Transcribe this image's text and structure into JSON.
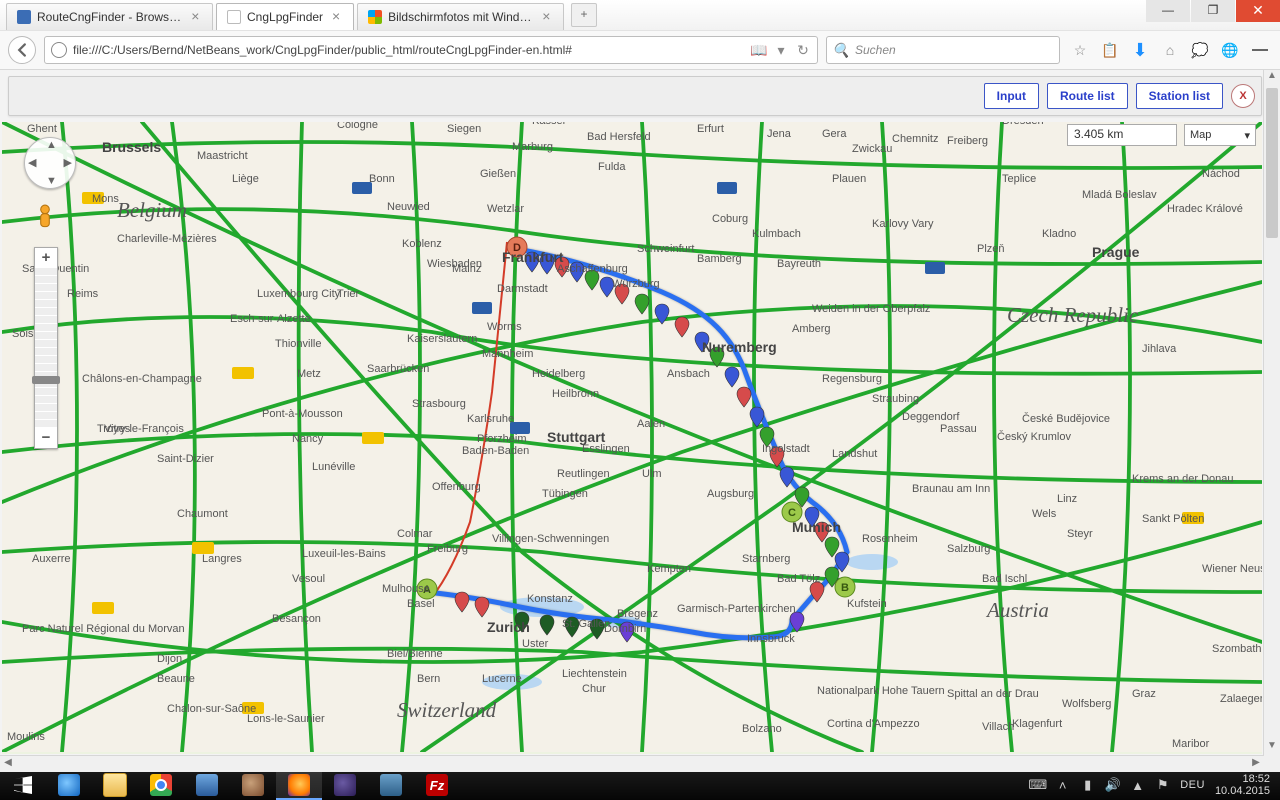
{
  "window": {
    "tabs": [
      {
        "label": "RouteCngFinder - Browse …"
      },
      {
        "label": "CngLpgFinder"
      },
      {
        "label": "Bildschirmfotos mit Windo…"
      }
    ],
    "controls": {
      "min": "—",
      "max": "❐",
      "close": "✕"
    }
  },
  "toolbar": {
    "url": "file:///C:/Users/Bernd/NetBeans_work/CngLpgFinder/public_html/routeCngLpgFinder-en.html#",
    "search_placeholder": "Suchen",
    "icons": {
      "reader": "📖",
      "dropdown": "▾",
      "reload": "↻",
      "magnifier": "🔍",
      "star": "☆",
      "clipboard": "📋",
      "download": "⬇",
      "home": "⌂",
      "chat": "💭",
      "globe": "🌐"
    }
  },
  "app": {
    "buttons": {
      "input": "Input",
      "route_list": "Route list",
      "station_list": "Station list"
    },
    "close": "X"
  },
  "map": {
    "distance": "3.405 km",
    "type": "Map",
    "countries": {
      "be": "Belgium",
      "ch": "Switzerland",
      "at": "Austria",
      "cz": "Czech Republic",
      "li": "Liechtenstein"
    },
    "cities": {
      "brussels": "Brussels",
      "maastricht": "Maastricht",
      "cologne": "Cologne",
      "siegen": "Siegen",
      "bonn": "Bonn",
      "koblenz": "Koblenz",
      "frankfurt": "Frankfurt",
      "darmstadt": "Darmstadt",
      "mannheim": "Mannheim",
      "heidelberg": "Heidelberg",
      "karlsruhe": "Karlsruhe",
      "stuttgart": "Stuttgart",
      "pforzheim": "Pforzheim",
      "freiburg": "Freiburg",
      "basel": "Basel",
      "zurich": "Zurich",
      "konstanz": "Konstanz",
      "stgallen": "St. Gallen",
      "ulm": "Ulm",
      "augsburg": "Augsburg",
      "munich": "Munich",
      "nuremberg": "Nuremberg",
      "wurzburg": "Würzburg",
      "regensburg": "Regensburg",
      "ingolstadt": "Ingolstadt",
      "salzburg": "Salzburg",
      "innsbruck": "Innsbruck",
      "linz": "Linz",
      "graz": "Graz",
      "klagenfurt": "Klagenfurt",
      "prague": "Prague",
      "plzen": "Plzeň",
      "dresden": "Dresden",
      "chemnitz": "Chemnitz",
      "erfurt": "Erfurt",
      "kassel": "Kassel",
      "marburg": "Marburg",
      "fulda": "Fulda",
      "bayreuth": "Bayreuth",
      "bamberg": "Bamberg",
      "schweinfurt": "Schweinfurt",
      "aschaffen": "Aschaffenburg",
      "mainz": "Mainz",
      "wiesbaden": "Wiesbaden",
      "trier": "Trier",
      "lux": "Luxembourg City",
      "metz": "Metz",
      "nancy": "Nancy",
      "strasbourg": "Strasbourg",
      "reims": "Reims",
      "liege": "Liège",
      "mons": "Mons",
      "gent": "Ghent",
      "saarbrucken": "Saarbrücken",
      "mulhouse": "Mulhouse",
      "colmar": "Colmar",
      "dijon": "Dijon",
      "besancon": "Besançon",
      "troyes": "Troyes",
      "reutlingen": "Reutlingen",
      "tubingen": "Tübingen",
      "heilbronn": "Heilbronn",
      "esslingen": "Esslingen",
      "aalen": "Aalen",
      "kempten": "Kempten",
      "lucerne": "Lucerne",
      "bern": "Bern",
      "biel": "Biel/Bienne",
      "passau": "Passau",
      "landshut": "Landshut",
      "rosenheim": "Rosenheim",
      "kufstein": "Kufstein",
      "badtolz": "Bad Tölz",
      "starnberg": "Starnberg",
      "amberg": "Amberg",
      "ansbach": "Ansbach",
      "coburg": "Coburg",
      "zwickau": "Zwickau",
      "gera": "Gera",
      "jena": "Jena",
      "freiberg2": "Freiberg",
      "karlovy": "Karlovy Vary",
      "budejovice": "České Budějovice",
      "jihlava": "Jihlava",
      "hradec": "Hradec Králové",
      "badhersfeld": "Bad Hersfeld",
      "giessen": "Gießen",
      "neuwied": "Neuwied",
      "wetzlar": "Wetzlar",
      "worms": "Worms",
      "offenburg": "Offenburg",
      "badenbad": "Baden-Baden",
      "villingen": "Villingen-Schwenningen",
      "kulmbach": "Kulmbach",
      "plauen": "Plauen",
      "weiden": "Weiden in der Oberpfalz",
      "straubing": "Straubing",
      "deggendorf": "Deggendorf",
      "braunau": "Braunau am Inn",
      "wels": "Wels",
      "steyr": "Steyr",
      "badischl": "Bad Ischl",
      "stpolten": "Sankt Pölten",
      "wrneustadt": "Wiener Neustadt",
      "dornbirn": "Dornbirn",
      "bregenz": "Bregenz",
      "chur": "Chur",
      "uster": "Uster",
      "garmisch": "Garmisch-Partenkirchen",
      "bolzano": "Bolzano",
      "cortina": "Cortina d'Ampezzo",
      "spittal": "Spittal an der Drau",
      "villach": "Villach",
      "wolfsberg": "Wolfsberg",
      "charleville": "Charleville-Mézières",
      "stquentin": "Saint-Quentin",
      "soissons": "Soissons",
      "chalons": "Châlons-en-Champagne",
      "vitry": "Vitry-le-François",
      "stdizier": "Saint-Dizier",
      "chaumont": "Chaumont",
      "langres": "Langres",
      "vesoul": "Vesoul",
      "luxeuil": "Luxeuil-les-Bains",
      "pontam": "Pont-à-Mousson",
      "luneville": "Lunéville",
      "thionville": "Thionville",
      "esch": "Esch-sur-Alzette",
      "hohetauern": "Nationalpark Hohe Tauern",
      "krems": "Krems an der Donau",
      "teplice": "Teplice",
      "kladno": "Kladno",
      "mlada": "Mladá Boleslav",
      "nachod": "Náchod",
      "szombat": "Szombathely",
      "zalaeg": "Zalaegerszeg",
      "maribor": "Maribor",
      "auxerre": "Auxerre",
      "moulins": "Moulins",
      "beaune": "Beaune",
      "chalonss": "Chalon-sur-Saône",
      "lons": "Lons-le-Saunier",
      "pnrmorvan": "Parc Naturel Régional du Morvan",
      "budejovice2": "Český Krumlov",
      "kaiserslautern": "Kaiserslautern"
    },
    "waypoints": {
      "a": "A",
      "b": "B",
      "c": "C",
      "d": "D"
    }
  },
  "taskbar": {
    "lang": "DEU",
    "time": "18:52",
    "date": "10.04.2015",
    "fz": "Fz"
  }
}
